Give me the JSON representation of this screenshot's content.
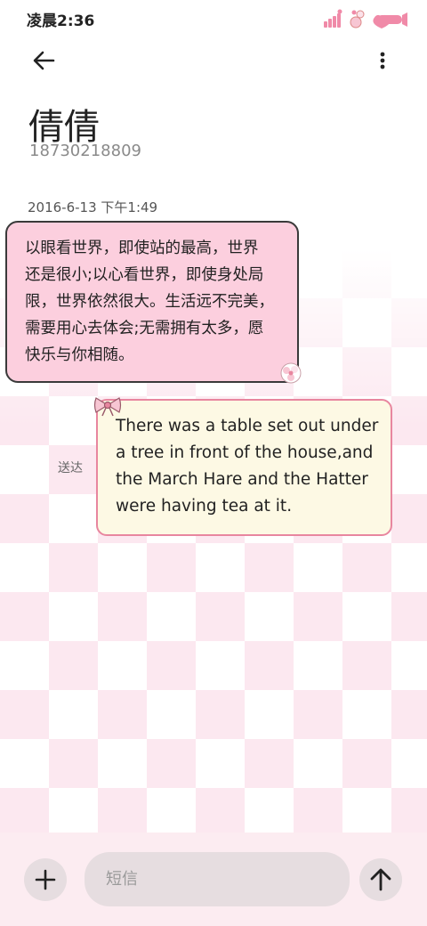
{
  "status_bar": {
    "time": "凌晨2:36",
    "icons": [
      "signal-icon",
      "wifi-flower-icon",
      "battery-heart-icon"
    ]
  },
  "header": {
    "back_icon": "arrow-left-icon",
    "more_icon": "more-vertical-icon"
  },
  "contact": {
    "name": "倩倩",
    "number": "18730218809"
  },
  "conversation": {
    "date": "2016-6-13 下午1:49",
    "messages": [
      {
        "direction": "incoming",
        "lines": [
          "以眼看世界，即使站的最高，世界",
          "还是很小;以心看世界，即使身处局",
          "限，世界依然很大。生活远不完美，",
          "需要用心去体会;无需拥有太多，愿",
          "快乐与你相随。"
        ]
      },
      {
        "direction": "outgoing",
        "status": "送达",
        "lines": [
          "There was a table set out under",
          "a tree in front of the house,and",
          "the March Hare and the Hatter",
          "were having tea at it."
        ]
      }
    ]
  },
  "composer": {
    "add_icon": "plus-icon",
    "placeholder": "短信",
    "send_icon": "arrow-up-icon"
  },
  "colors": {
    "incoming_bubble": "#fccfde",
    "outgoing_bubble": "#fdf9e4",
    "outgoing_border": "#e8869f",
    "bottom_bar": "#fcecf1",
    "pattern": "#fce6ef"
  }
}
